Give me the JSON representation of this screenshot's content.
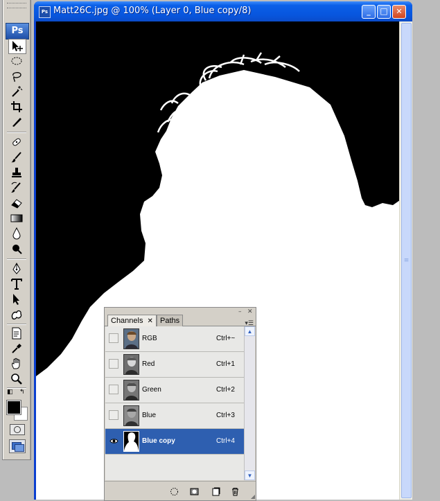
{
  "app": {
    "logo": "Ps"
  },
  "window": {
    "title": "Matt26C.jpg @ 100% (Layer 0, Blue copy/8)",
    "doc_icon": "Ps",
    "buttons": {
      "minimize": "_",
      "maximize": "□",
      "close": "✕"
    }
  },
  "tools": [
    "move-tool-icon",
    "marquee-tool-icon",
    "lasso-tool-icon",
    "magic-wand-icon",
    "crop-tool-icon",
    "slice-tool-icon",
    "healing-brush-icon",
    "brush-tool-icon",
    "clone-stamp-icon",
    "history-brush-icon",
    "eraser-tool-icon",
    "gradient-tool-icon",
    "blur-tool-icon",
    "dodge-tool-icon",
    "pen-tool-icon",
    "type-tool-icon",
    "path-selection-icon",
    "custom-shape-icon",
    "notes-tool-icon",
    "eyedropper-icon",
    "hand-tool-icon",
    "zoom-tool-icon"
  ],
  "colors": {
    "foreground": "#000000",
    "background": "#ffffff",
    "selection": "#2e5fb0",
    "titlebar": "#0855dd"
  },
  "panel": {
    "tabs": [
      {
        "label": "Channels",
        "close": "✕",
        "active": true
      },
      {
        "label": "Paths",
        "active": false
      }
    ],
    "controls": {
      "minimize": "–",
      "close": "✕",
      "menu": "▾☰"
    },
    "channels": [
      {
        "name": "RGB",
        "shortcut": "Ctrl+~",
        "visible": false,
        "selected": false
      },
      {
        "name": "Red",
        "shortcut": "Ctrl+1",
        "visible": false,
        "selected": false
      },
      {
        "name": "Green",
        "shortcut": "Ctrl+2",
        "visible": false,
        "selected": false
      },
      {
        "name": "Blue",
        "shortcut": "Ctrl+3",
        "visible": false,
        "selected": false
      },
      {
        "name": "Blue copy",
        "shortcut": "Ctrl+4",
        "visible": true,
        "selected": true
      }
    ],
    "footer_buttons": [
      "load-selection-icon",
      "save-selection-icon",
      "new-channel-icon",
      "delete-channel-icon"
    ]
  }
}
